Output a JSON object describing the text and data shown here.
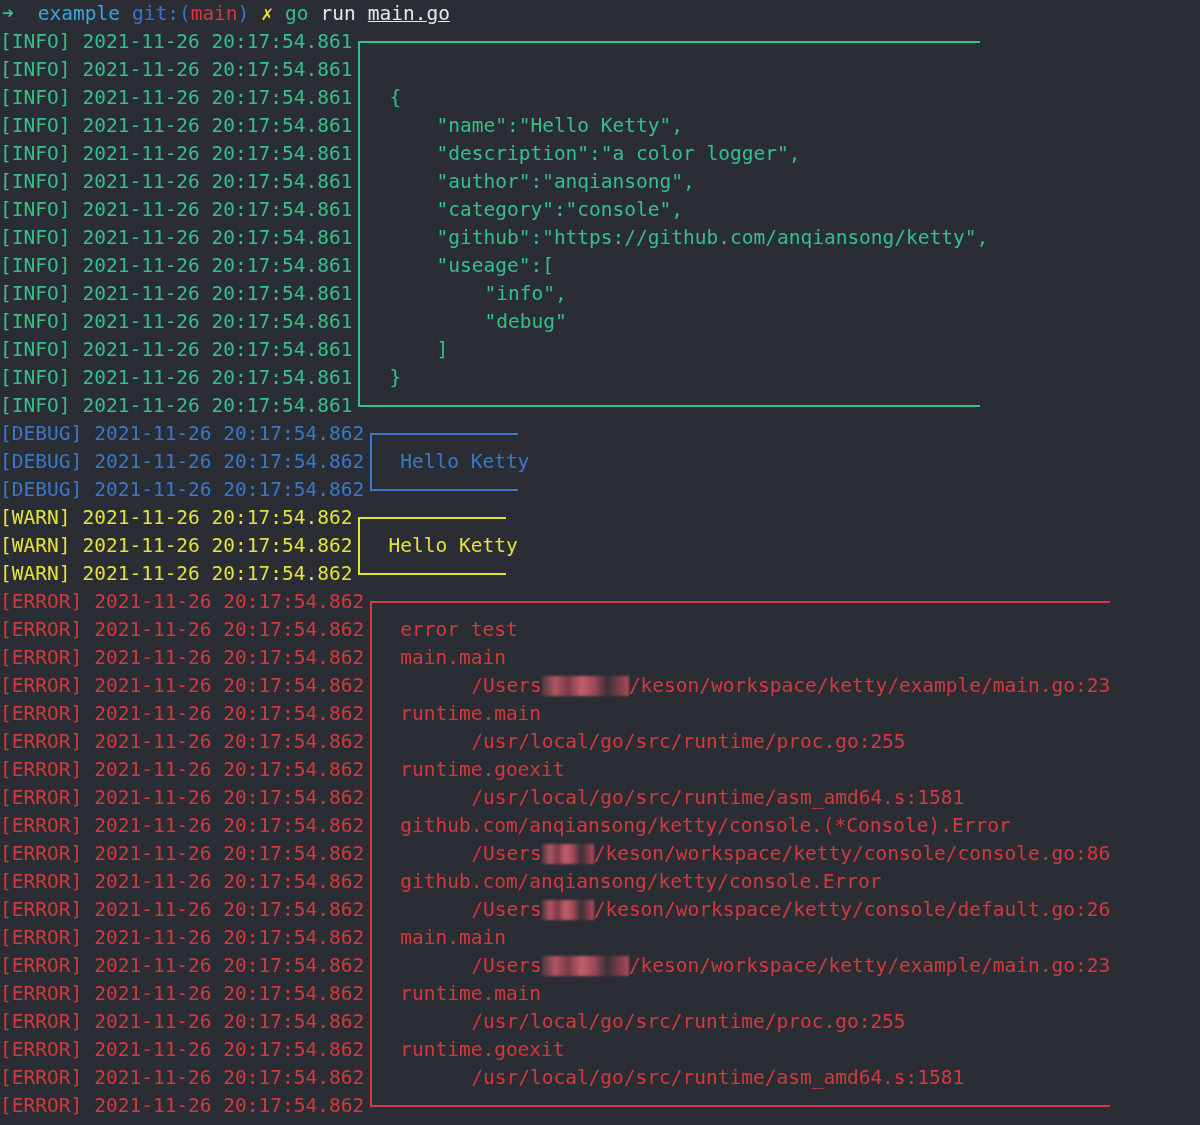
{
  "prompt": {
    "arrow": "➜",
    "directory": "example",
    "git_label": "git:(",
    "branch": "main",
    "git_close": ")",
    "dirty_mark": "✗",
    "command": "go",
    "argument": "run",
    "file": "main.go"
  },
  "groups": [
    {
      "kind": "info",
      "color": "#35c08a",
      "rows": [
        {
          "tag": "[INFO]",
          "time": "2021-11-26 20:17:54.861"
        },
        {
          "tag": "[INFO]",
          "time": "2021-11-26 20:17:54.861"
        },
        {
          "tag": "[INFO]",
          "time": "2021-11-26 20:17:54.861"
        },
        {
          "tag": "[INFO]",
          "time": "2021-11-26 20:17:54.861"
        },
        {
          "tag": "[INFO]",
          "time": "2021-11-26 20:17:54.861"
        },
        {
          "tag": "[INFO]",
          "time": "2021-11-26 20:17:54.861"
        },
        {
          "tag": "[INFO]",
          "time": "2021-11-26 20:17:54.861"
        },
        {
          "tag": "[INFO]",
          "time": "2021-11-26 20:17:54.861"
        },
        {
          "tag": "[INFO]",
          "time": "2021-11-26 20:17:54.861"
        },
        {
          "tag": "[INFO]",
          "time": "2021-11-26 20:17:54.861"
        },
        {
          "tag": "[INFO]",
          "time": "2021-11-26 20:17:54.861"
        },
        {
          "tag": "[INFO]",
          "time": "2021-11-26 20:17:54.861"
        },
        {
          "tag": "[INFO]",
          "time": "2021-11-26 20:17:54.861"
        },
        {
          "tag": "[INFO]",
          "time": "2021-11-26 20:17:54.861"
        }
      ],
      "content": [
        {
          "kind": "open",
          "text": "{"
        },
        {
          "kind": "field",
          "text": "\"name\":\"Hello Ketty\","
        },
        {
          "kind": "field",
          "text": "\"description\":\"a color logger\","
        },
        {
          "kind": "field",
          "text": "\"author\":\"anqiansong\","
        },
        {
          "kind": "field",
          "text": "\"category\":\"console\","
        },
        {
          "kind": "field",
          "text": "\"github\":\"https://github.com/anqiansong/ketty\","
        },
        {
          "kind": "field",
          "text": "\"useage\":["
        },
        {
          "kind": "item",
          "text": "\"info\","
        },
        {
          "kind": "item",
          "text": "\"debug\""
        },
        {
          "kind": "field",
          "text": "]"
        },
        {
          "kind": "open",
          "text": "}"
        }
      ]
    },
    {
      "kind": "debug",
      "color": "#3a78c9",
      "rows": [
        {
          "tag": "[DEBUG]",
          "time": "2021-11-26 20:17:54.862"
        },
        {
          "tag": "[DEBUG]",
          "time": "2021-11-26 20:17:54.862"
        },
        {
          "tag": "[DEBUG]",
          "time": "2021-11-26 20:17:54.862"
        }
      ],
      "content": [
        {
          "kind": "message",
          "text": "Hello Ketty"
        }
      ]
    },
    {
      "kind": "warn",
      "color": "#e5e23a",
      "rows": [
        {
          "tag": "[WARN]",
          "time": "2021-11-26 20:17:54.862"
        },
        {
          "tag": "[WARN]",
          "time": "2021-11-26 20:17:54.862"
        },
        {
          "tag": "[WARN]",
          "time": "2021-11-26 20:17:54.862"
        }
      ],
      "content": [
        {
          "kind": "message",
          "text": "Hello Ketty"
        }
      ]
    },
    {
      "kind": "error",
      "color": "#d23a3e",
      "rows": [
        {
          "tag": "[ERROR]",
          "time": "2021-11-26 20:17:54.862"
        },
        {
          "tag": "[ERROR]",
          "time": "2021-11-26 20:17:54.862"
        },
        {
          "tag": "[ERROR]",
          "time": "2021-11-26 20:17:54.862"
        },
        {
          "tag": "[ERROR]",
          "time": "2021-11-26 20:17:54.862"
        },
        {
          "tag": "[ERROR]",
          "time": "2021-11-26 20:17:54.862"
        },
        {
          "tag": "[ERROR]",
          "time": "2021-11-26 20:17:54.862"
        },
        {
          "tag": "[ERROR]",
          "time": "2021-11-26 20:17:54.862"
        },
        {
          "tag": "[ERROR]",
          "time": "2021-11-26 20:17:54.862"
        },
        {
          "tag": "[ERROR]",
          "time": "2021-11-26 20:17:54.862"
        },
        {
          "tag": "[ERROR]",
          "time": "2021-11-26 20:17:54.862"
        },
        {
          "tag": "[ERROR]",
          "time": "2021-11-26 20:17:54.862"
        },
        {
          "tag": "[ERROR]",
          "time": "2021-11-26 20:17:54.862"
        },
        {
          "tag": "[ERROR]",
          "time": "2021-11-26 20:17:54.862"
        },
        {
          "tag": "[ERROR]",
          "time": "2021-11-26 20:17:54.862"
        },
        {
          "tag": "[ERROR]",
          "time": "2021-11-26 20:17:54.862"
        },
        {
          "tag": "[ERROR]",
          "time": "2021-11-26 20:17:54.862"
        },
        {
          "tag": "[ERROR]",
          "time": "2021-11-26 20:17:54.862"
        },
        {
          "tag": "[ERROR]",
          "time": "2021-11-26 20:17:54.862"
        },
        {
          "tag": "[ERROR]",
          "time": "2021-11-26 20:17:54.862"
        }
      ],
      "content": [
        {
          "kind": "message",
          "text": "error test"
        },
        {
          "kind": "func",
          "text": "main.main"
        },
        {
          "kind": "path",
          "text": "/Users",
          "redacted": true,
          "tail": "/keson/workspace/ketty/example/main.go:23"
        },
        {
          "kind": "func",
          "text": "runtime.main"
        },
        {
          "kind": "path",
          "text": "/usr/local/go/src/runtime/proc.go:255",
          "redacted": false
        },
        {
          "kind": "func",
          "text": "runtime.goexit"
        },
        {
          "kind": "path",
          "text": "/usr/local/go/src/runtime/asm_amd64.s:1581",
          "redacted": false
        },
        {
          "kind": "func",
          "text": "github.com/anqiansong/ketty/console.(*Console).Error"
        },
        {
          "kind": "path",
          "text": "/Users",
          "redacted": true,
          "tail": "/keson/workspace/ketty/console/console.go:86"
        },
        {
          "kind": "func",
          "text": "github.com/anqiansong/ketty/console.Error"
        },
        {
          "kind": "path",
          "text": "/Users",
          "redacted": true,
          "tail": "/keson/workspace/ketty/console/default.go:26"
        },
        {
          "kind": "func",
          "text": "main.main"
        },
        {
          "kind": "path",
          "text": "/Users",
          "redacted": true,
          "tail": "/keson/workspace/ketty/example/main.go:23"
        },
        {
          "kind": "func",
          "text": "runtime.main"
        },
        {
          "kind": "path",
          "text": "/usr/local/go/src/runtime/proc.go:255",
          "redacted": false
        },
        {
          "kind": "func",
          "text": "runtime.goexit"
        },
        {
          "kind": "path",
          "text": "/usr/local/go/src/runtime/asm_amd64.s:1581",
          "redacted": false
        }
      ]
    }
  ]
}
